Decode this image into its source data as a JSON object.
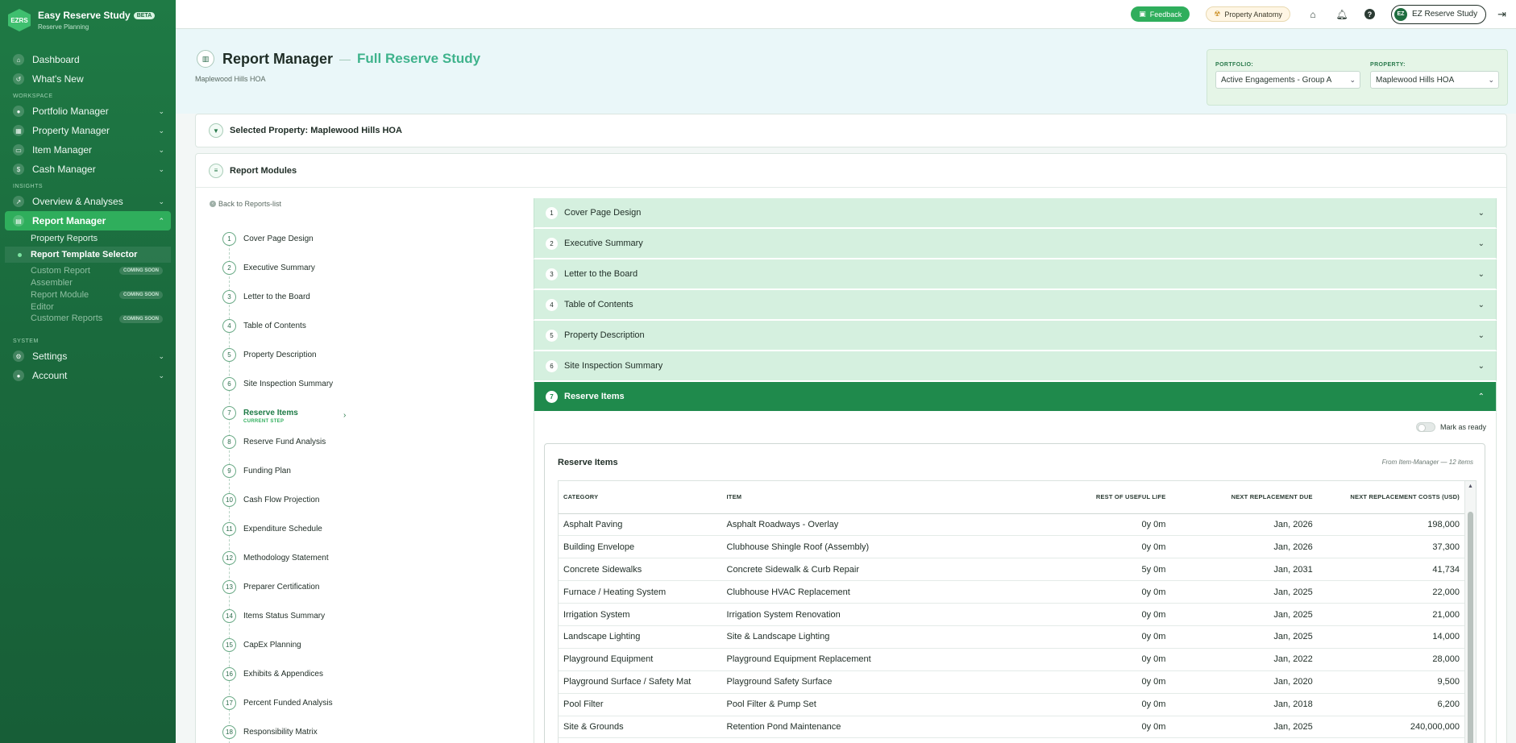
{
  "brand": {
    "logo": "EZRS",
    "name": "Easy Reserve Study",
    "badge": "BETA",
    "tagline": "Reserve Planning"
  },
  "nav": {
    "dashboard": "Dashboard",
    "whats_new": "What's New",
    "workspace_label": "WORKSPACE",
    "portfolio": "Portfolio Manager",
    "property": "Property Manager",
    "item": "Item Manager",
    "cash": "Cash Manager",
    "insights_label": "INSIGHTS",
    "overview": "Overview & Analyses",
    "report": "Report Manager",
    "sub": {
      "property_reports": "Property Reports",
      "template_selector": "Report Template Selector",
      "custom_assembler": "Custom Report Assembler",
      "module_editor": "Report Module Editor",
      "customer_reports": "Customer Reports",
      "coming_soon": "COMING SOON"
    },
    "system_label": "SYSTEM",
    "settings": "Settings",
    "account": "Account"
  },
  "topbar": {
    "feedback": "Feedback",
    "anatomy": "Property Anatomy",
    "user_initials": "EZ",
    "user_name": "EZ Reserve Study"
  },
  "header": {
    "title": "Report Manager",
    "separator": "—",
    "subtitle": "Full Reserve Study",
    "property_name": "Maplewood Hills HOA",
    "portfolio_label": "PORTFOLIO:",
    "portfolio_value": "Active Engagements - Group A",
    "property_label": "PROPERTY:",
    "property_value": "Maplewood Hills HOA"
  },
  "selected_property": "Selected Property: Maplewood Hills HOA",
  "modules": {
    "title": "Report Modules",
    "back": "Back to Reports-list",
    "current_step_label": "CURRENT STEP",
    "steps": [
      {
        "n": "1",
        "label": "Cover Page Design"
      },
      {
        "n": "2",
        "label": "Executive Summary"
      },
      {
        "n": "3",
        "label": "Letter to the Board"
      },
      {
        "n": "4",
        "label": "Table of Contents"
      },
      {
        "n": "5",
        "label": "Property Description"
      },
      {
        "n": "6",
        "label": "Site Inspection Summary"
      },
      {
        "n": "7",
        "label": "Reserve Items"
      },
      {
        "n": "8",
        "label": "Reserve Fund Analysis"
      },
      {
        "n": "9",
        "label": "Funding Plan"
      },
      {
        "n": "10",
        "label": "Cash Flow Projection"
      },
      {
        "n": "11",
        "label": "Expenditure Schedule"
      },
      {
        "n": "12",
        "label": "Methodology Statement"
      },
      {
        "n": "13",
        "label": "Preparer Certification"
      },
      {
        "n": "14",
        "label": "Items Status Summary"
      },
      {
        "n": "15",
        "label": "CapEx Planning"
      },
      {
        "n": "16",
        "label": "Exhibits & Appendices"
      },
      {
        "n": "17",
        "label": "Percent Funded Analysis"
      },
      {
        "n": "18",
        "label": "Responsibility Matrix"
      }
    ]
  },
  "reserve_items": {
    "mark_ready": "Mark as ready",
    "title": "Reserve Items",
    "meta": "From Item-Manager — 12 items",
    "columns": [
      "CATEGORY",
      "ITEM",
      "REST OF USEFUL LIFE",
      "NEXT REPLACEMENT DUE",
      "NEXT REPLACEMENT COSTS (USD)"
    ],
    "rows": [
      [
        "Asphalt Paving",
        "Asphalt Roadways - Overlay",
        "0y 0m",
        "Jan, 2026",
        "198,000"
      ],
      [
        "Building Envelope",
        "Clubhouse Shingle Roof (Assembly)",
        "0y 0m",
        "Jan, 2026",
        "37,300"
      ],
      [
        "Concrete Sidewalks",
        "Concrete Sidewalk & Curb Repair",
        "5y 0m",
        "Jan, 2031",
        "41,734"
      ],
      [
        "Furnace / Heating System",
        "Clubhouse HVAC Replacement",
        "0y 0m",
        "Jan, 2025",
        "22,000"
      ],
      [
        "Irrigation System",
        "Irrigation System Renovation",
        "0y 0m",
        "Jan, 2025",
        "21,000"
      ],
      [
        "Landscape Lighting",
        "Site & Landscape Lighting",
        "0y 0m",
        "Jan, 2025",
        "14,000"
      ],
      [
        "Playground Equipment",
        "Playground Equipment Replacement",
        "0y 0m",
        "Jan, 2022",
        "28,000"
      ],
      [
        "Playground Surface / Safety Mat",
        "Playground Safety Surface",
        "0y 0m",
        "Jan, 2020",
        "9,500"
      ],
      [
        "Pool Filter",
        "Pool Filter & Pump Set",
        "0y 0m",
        "Jan, 2018",
        "6,200"
      ],
      [
        "Site & Grounds",
        "Retention Pond Maintenance",
        "0y 0m",
        "Jan, 2025",
        "240,000,000"
      ]
    ]
  }
}
